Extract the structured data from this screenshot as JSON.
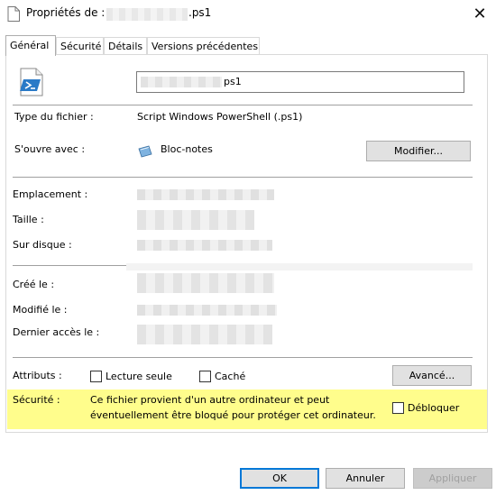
{
  "window": {
    "title_prefix": "Propriétés de :",
    "title_ext": ".ps1",
    "close_glyph": "✕"
  },
  "tabs": [
    {
      "label": "Général",
      "active": true
    },
    {
      "label": "Sécurité",
      "active": false
    },
    {
      "label": "Détails",
      "active": false
    },
    {
      "label": "Versions précédentes",
      "active": false
    }
  ],
  "file": {
    "name_ext": "ps1",
    "type_label": "Type du fichier :",
    "type_value": "Script Windows PowerShell (.ps1)",
    "opens_label": "S'ouvre avec :",
    "opens_value": "Bloc-notes",
    "modify_button": "Modifier..."
  },
  "location": {
    "location_label": "Emplacement :",
    "size_label": "Taille :",
    "disk_label": "Sur disque :"
  },
  "dates": {
    "created_label": "Créé le :",
    "modified_label": "Modifié le :",
    "accessed_label": "Dernier accès le :"
  },
  "attributes": {
    "label": "Attributs :",
    "readonly_label": "Lecture seule",
    "readonly_checked": false,
    "hidden_label": "Caché",
    "hidden_checked": false,
    "advanced_button": "Avancé..."
  },
  "security": {
    "label": "Sécurité :",
    "message_line1": "Ce fichier provient d'un autre ordinateur et peut",
    "message_line2": "éventuellement être bloqué pour protéger cet ordinateur.",
    "unblock_label": "Débloquer",
    "unblock_checked": false,
    "highlight_color": "#fffd8c"
  },
  "buttons": {
    "ok": "OK",
    "cancel": "Annuler",
    "apply": "Appliquer"
  },
  "colors": {
    "accent": "#0078d7"
  }
}
